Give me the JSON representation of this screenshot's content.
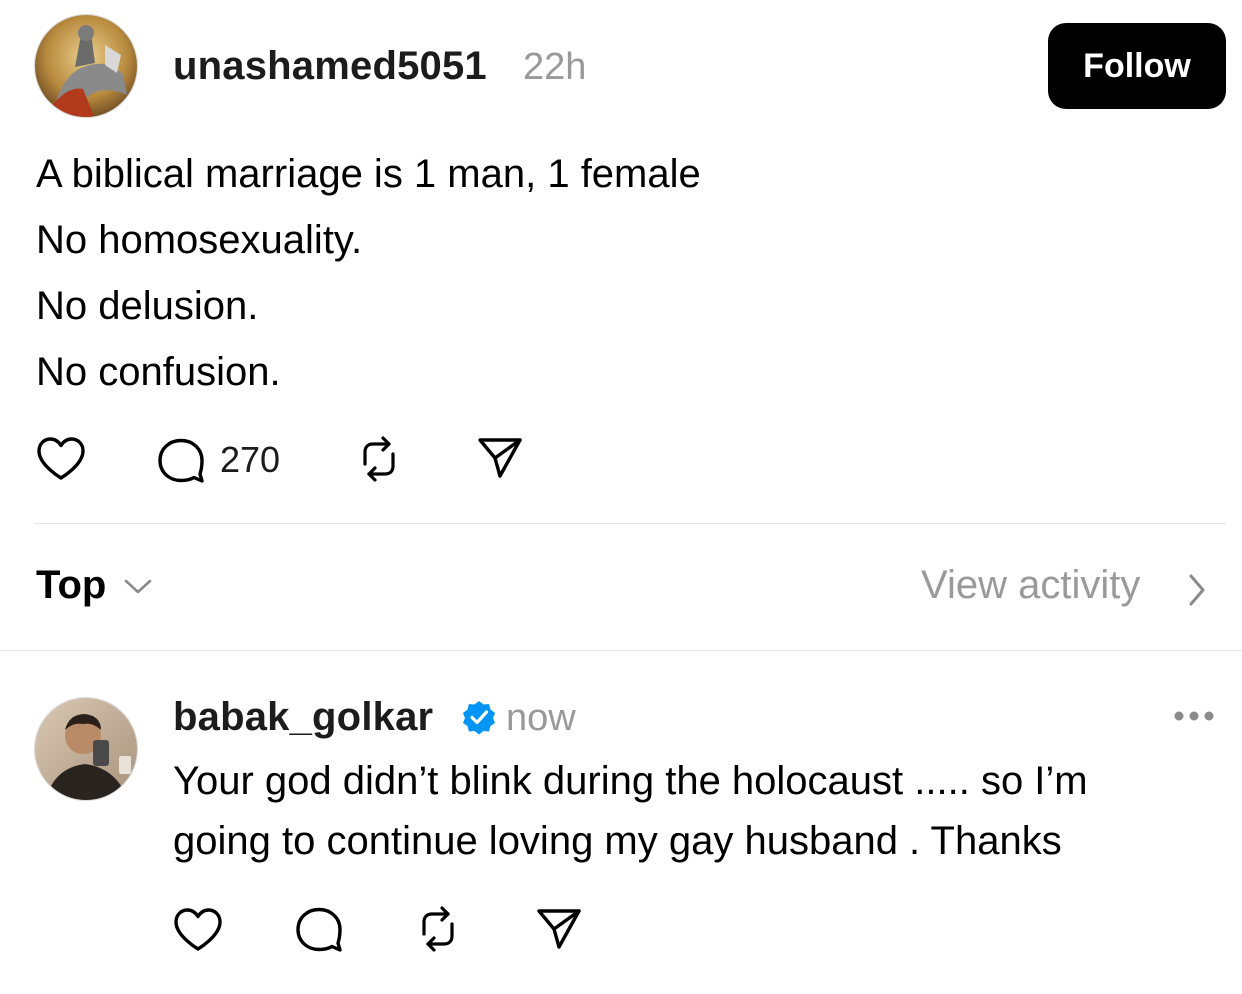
{
  "post": {
    "username": "unashamed5051",
    "timestamp": "22h",
    "follow_label": "Follow",
    "lines": [
      "A biblical marriage is 1 man, 1 female",
      "No homosexuality.",
      "No delusion.",
      "No confusion."
    ],
    "reply_count": "270"
  },
  "sort": {
    "selected": "Top",
    "view_activity": "View activity"
  },
  "reply": {
    "username": "babak_golkar",
    "verified": true,
    "timestamp": "now",
    "lines": [
      "Your god didn’t blink during the holocaust ..... so I’m",
      "going to continue loving my gay husband .  Thanks"
    ]
  },
  "colors": {
    "verified_blue": "#0095f6",
    "muted_text": "#999999",
    "follow_bg": "#000000",
    "divider": "#e3e3e3"
  },
  "icons": [
    "heart-icon",
    "comment-icon",
    "repost-icon",
    "share-icon",
    "chevron-down-icon",
    "chevron-right-icon",
    "more-icon",
    "verified-badge-icon"
  ]
}
